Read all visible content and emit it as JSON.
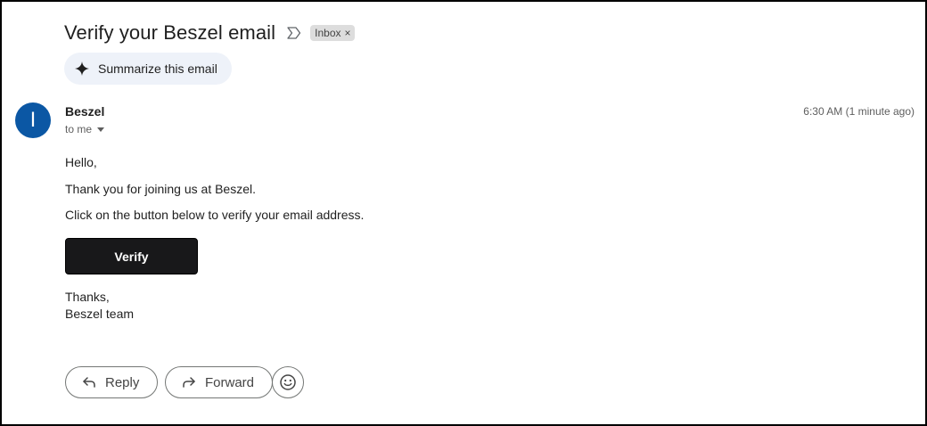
{
  "email": {
    "subject": "Verify your Beszel email",
    "label": "Inbox",
    "label_remove": "×",
    "summarize_label": "Summarize this email",
    "sender": {
      "name": "Beszel",
      "avatar_letter": "I",
      "avatar_color": "#0b57a4",
      "recipient": "to me"
    },
    "timestamp": "6:30 AM (1 minute ago)",
    "body": {
      "greeting": "Hello,",
      "line1": "Thank you for joining us at Beszel.",
      "line2": "Click on the button below to verify your email address.",
      "button_label": "Verify",
      "signoff": "Thanks,",
      "signature": "Beszel team"
    }
  },
  "actions": {
    "reply_label": "Reply",
    "forward_label": "Forward"
  },
  "icons": {
    "important": "important-marker-icon",
    "sparkle": "sparkle-icon",
    "reply": "reply-arrow-icon",
    "forward": "forward-arrow-icon",
    "emoji": "emoji-smile-icon"
  }
}
